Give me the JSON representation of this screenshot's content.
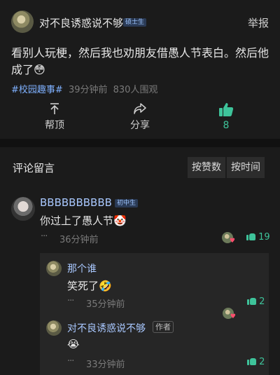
{
  "post": {
    "author": "对不良诱惑说不够",
    "author_badge": "硕士生",
    "report": "举报",
    "content": "看别人玩梗，然后我也劝朋友借愚人节表白。然后他成了😳",
    "topic": "#校园趣事#",
    "time": "39分钟前",
    "views": "830人围观"
  },
  "actions": {
    "top_label": "帮顶",
    "share_label": "分享",
    "like_count": "8"
  },
  "comments": {
    "title": "评论留言",
    "sort_by_likes": "按赞数",
    "sort_by_time": "按时间",
    "items": [
      {
        "author": "BBBBBBBBBB",
        "badge": "初中生",
        "text": "你过上了愚人节🤡",
        "time": "36分钟前",
        "likes": "19",
        "replies": [
          {
            "author": "那个谁",
            "text": "笑死了🤣",
            "time": "35分钟前",
            "likes": "2"
          },
          {
            "author": "对不良诱惑说不够",
            "author_tag": "作者",
            "text": "😭",
            "time": "33分钟前",
            "likes": "2"
          }
        ]
      }
    ]
  },
  "colors": {
    "accent_like": "#3ec39a",
    "badge_text": "#9fc6ff",
    "background": "#1b1b1b"
  }
}
